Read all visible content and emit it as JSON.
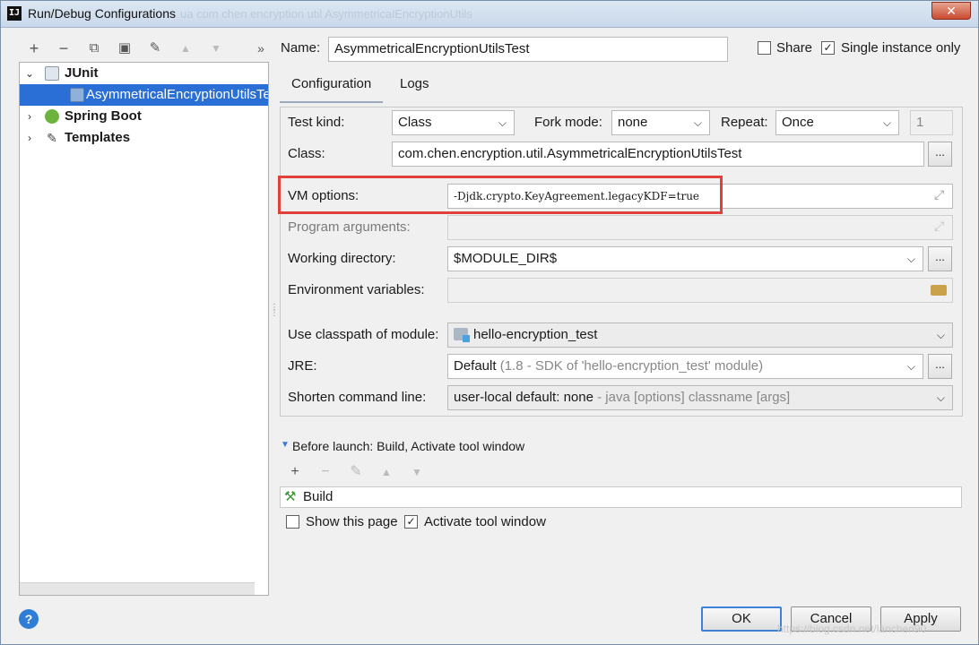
{
  "window": {
    "title": "Run/Debug Configurations",
    "app_icon_text": "IJ",
    "title_ghost": "ua  com  chen  encryption  util  AsymmetricalEncryptionUtils",
    "close_glyph": "✕"
  },
  "left": {
    "toolbar": [
      "+",
      "−",
      "⧉",
      "▣",
      "✎",
      "▲",
      "▼",
      "»"
    ],
    "tree": [
      {
        "label": "JUnit",
        "expanded": true,
        "level": 0,
        "bold": true
      },
      {
        "label": "AsymmetricalEncryptionUtilsTest",
        "level": 1,
        "selected": true
      },
      {
        "label": "Spring Boot",
        "expanded": false,
        "level": 0,
        "bold": true
      },
      {
        "label": "Templates",
        "expanded": false,
        "level": 0,
        "bold": true
      }
    ]
  },
  "header": {
    "name_label": "Name:",
    "name_value": "AsymmetricalEncryptionUtilsTest",
    "share_label": "Share",
    "share_checked": false,
    "single_label": "Single instance only",
    "single_checked": true
  },
  "tabs": [
    "Configuration",
    "Logs"
  ],
  "config": {
    "test_kind_label": "Test kind:",
    "test_kind_value": "Class",
    "fork_mode_label": "Fork mode:",
    "fork_mode_value": "none",
    "repeat_label": "Repeat:",
    "repeat_value": "Once",
    "repeat_count": "1",
    "class_label": "Class:",
    "class_value": "com.chen.encryption.util.AsymmetricalEncryptionUtilsTest",
    "vm_options_label": "VM options:",
    "vm_options_value": "-Djdk.crypto.KeyAgreement.legacyKDF=true",
    "program_args_label": "Program arguments:",
    "program_args_value": "",
    "working_dir_label": "Working directory:",
    "working_dir_value": "$MODULE_DIR$",
    "env_label": "Environment variables:",
    "env_value": "",
    "classpath_label": "Use classpath of module:",
    "classpath_value": "hello-encryption_test",
    "jre_label": "JRE:",
    "jre_value": "Default",
    "jre_hint": "(1.8 - SDK of 'hello-encryption_test' module)",
    "shorten_label": "Shorten command line:",
    "shorten_value": "user-local default: none",
    "shorten_hint": "- java [options] classname [args]",
    "ellipsis": "..."
  },
  "before_launch": {
    "header": "Before launch: Build, Activate tool window",
    "toolbar": [
      "+",
      "−",
      "✎",
      "▲",
      "▼"
    ],
    "items": [
      "Build"
    ],
    "show_page_label": "Show this page",
    "show_page_checked": false,
    "activate_label": "Activate tool window",
    "activate_checked": true
  },
  "footer": {
    "help": "?",
    "ok": "OK",
    "cancel": "Cancel",
    "apply": "Apply",
    "watermark": "https://blog.csdn.net/lanchen90"
  },
  "colors": {
    "selection": "#2a6fd6",
    "highlight_box": "#e0413a",
    "help": "#2f7dd6"
  }
}
